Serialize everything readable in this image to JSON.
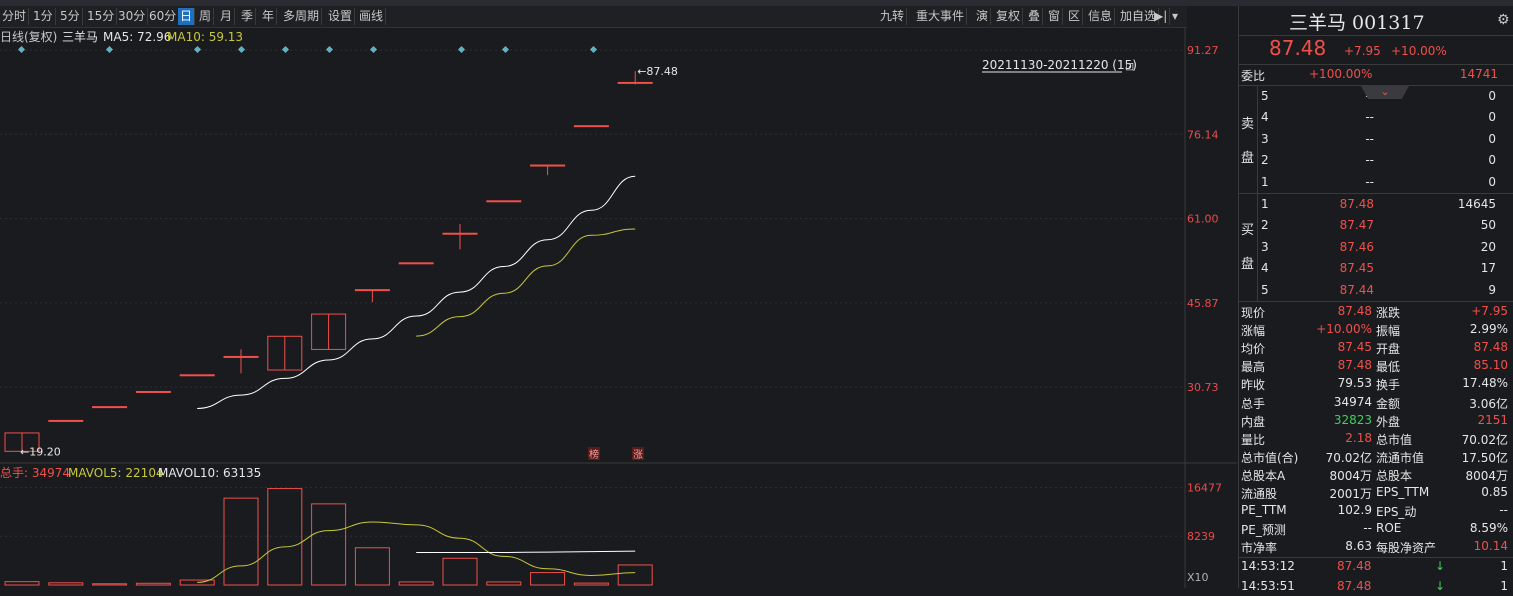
{
  "toolbar": {
    "periods": [
      "分时",
      "1分",
      "5分",
      "15分",
      "30分",
      "60分",
      "日",
      "周",
      "月",
      "季",
      "年",
      "多周期",
      "设置",
      "画线"
    ],
    "active": "日",
    "right_buttons": [
      "九转",
      "重大事件",
      "演",
      "复权",
      "叠",
      "窗",
      "区",
      "信息",
      "加自选"
    ]
  },
  "chart_legend": {
    "period_label": "日线(复权)",
    "stock_name": "三羊马",
    "ma5": "MA5: 72.96",
    "ma10": "MA10: 59.13"
  },
  "range_label": "20211130-20211220 (15)",
  "price_axis": [
    "91.27",
    "76.14",
    "61.00",
    "45.87",
    "30.73"
  ],
  "vol_axis": [
    "16477",
    "8239",
    "X10"
  ],
  "vol_legend": {
    "total": "总手: 34974",
    "mavol5": "MAVOL5: 22104",
    "mavol10": "MAVOL10: 63135"
  },
  "annotations": {
    "high": "87.48",
    "low": "19.20",
    "bang": "榜",
    "zhang": "涨"
  },
  "colors": {
    "up": "#f0504a",
    "ma5": "#ffffff",
    "ma10": "#c8c83a",
    "cyan": "#5ab4c8",
    "grid": "#2e2f35"
  },
  "chart_data": {
    "type": "candlestick",
    "dates_range": "20211130-20211220",
    "candles": [
      {
        "o": 19.2,
        "c": 22.5,
        "h": 22.5,
        "l": 19.2,
        "v": 3.5
      },
      {
        "o": 24.75,
        "c": 24.75,
        "h": 24.75,
        "l": 24.75,
        "v": 2.3
      },
      {
        "o": 27.23,
        "c": 27.23,
        "h": 27.23,
        "l": 27.23,
        "v": 1.3
      },
      {
        "o": 29.95,
        "c": 29.95,
        "h": 29.95,
        "l": 29.95,
        "v": 1.8
      },
      {
        "o": 32.95,
        "c": 32.95,
        "h": 32.95,
        "l": 32.95,
        "v": 5.2
      },
      {
        "o": 36.24,
        "c": 36.24,
        "h": 37.5,
        "l": 33.2,
        "v": 91
      },
      {
        "o": 33.8,
        "c": 39.86,
        "h": 39.86,
        "l": 33.8,
        "v": 101
      },
      {
        "o": 37.5,
        "c": 43.85,
        "h": 43.85,
        "l": 37.5,
        "v": 85
      },
      {
        "o": 48.24,
        "c": 48.24,
        "h": 48.24,
        "l": 46.0,
        "v": 39
      },
      {
        "o": 53.06,
        "c": 53.06,
        "h": 53.06,
        "l": 53.06,
        "v": 3.2
      },
      {
        "o": 58.37,
        "c": 58.37,
        "h": 60.0,
        "l": 55.5,
        "v": 28
      },
      {
        "o": 64.2,
        "c": 64.2,
        "h": 64.2,
        "l": 64.2,
        "v": 3.2
      },
      {
        "o": 70.62,
        "c": 70.62,
        "h": 70.62,
        "l": 68.8,
        "v": 13
      },
      {
        "o": 77.69,
        "c": 77.69,
        "h": 77.69,
        "l": 77.69,
        "v": 2.0
      },
      {
        "o": 85.46,
        "c": 85.46,
        "h": 87.48,
        "l": 85.1,
        "v": 21
      }
    ],
    "ma5": [
      null,
      null,
      null,
      null,
      26.9,
      29.3,
      32.3,
      35.6,
      39.4,
      43.5,
      47.8,
      52.4,
      57.2,
      62.5,
      68.6
    ],
    "ma10": [
      null,
      null,
      null,
      null,
      null,
      null,
      null,
      null,
      null,
      39.9,
      43.4,
      47.6,
      52.5,
      58.0,
      59.13
    ],
    "mavol5": [
      null,
      null,
      null,
      null,
      2.8,
      20,
      40,
      57,
      66,
      63,
      49,
      30,
      17,
      10,
      13
    ],
    "mavol10": [
      null,
      null,
      null,
      null,
      null,
      null,
      null,
      null,
      null,
      34,
      34,
      34,
      34.5,
      35,
      35.5
    ],
    "ylim": [
      18,
      92
    ],
    "vol_ylim": [
      0,
      110
    ]
  },
  "quote": {
    "title": "三羊马 001317",
    "price": "87.48",
    "change": "+7.95",
    "pct": "+10.00%",
    "weibi_label": "委比",
    "weibi": "+100.00%",
    "weicha": "14741",
    "sell_label": [
      "卖",
      "盘"
    ],
    "buy_label": [
      "买",
      "盘"
    ],
    "sell": [
      {
        "lvl": "5",
        "price": "--",
        "vol": "0"
      },
      {
        "lvl": "4",
        "price": "--",
        "vol": "0"
      },
      {
        "lvl": "3",
        "price": "--",
        "vol": "0"
      },
      {
        "lvl": "2",
        "price": "--",
        "vol": "0"
      },
      {
        "lvl": "1",
        "price": "--",
        "vol": "0"
      }
    ],
    "buy": [
      {
        "lvl": "1",
        "price": "87.48",
        "vol": "14645"
      },
      {
        "lvl": "2",
        "price": "87.47",
        "vol": "50"
      },
      {
        "lvl": "3",
        "price": "87.46",
        "vol": "20"
      },
      {
        "lvl": "4",
        "price": "87.45",
        "vol": "17"
      },
      {
        "lvl": "5",
        "price": "87.44",
        "vol": "9"
      }
    ],
    "stats": [
      {
        "k1": "现价",
        "v1": "87.48",
        "c1": "red",
        "k2": "涨跌",
        "v2": "+7.95",
        "c2": "red"
      },
      {
        "k1": "涨幅",
        "v1": "+10.00%",
        "c1": "red",
        "k2": "振幅",
        "v2": "2.99%",
        "c2": "white"
      },
      {
        "k1": "均价",
        "v1": "87.45",
        "c1": "red",
        "k2": "开盘",
        "v2": "87.48",
        "c2": "red"
      },
      {
        "k1": "最高",
        "v1": "87.48",
        "c1": "red",
        "k2": "最低",
        "v2": "85.10",
        "c2": "red"
      },
      {
        "k1": "昨收",
        "v1": "79.53",
        "c1": "white",
        "k2": "换手",
        "v2": "17.48%",
        "c2": "white"
      },
      {
        "k1": "总手",
        "v1": "34974",
        "c1": "white",
        "k2": "金额",
        "v2": "3.06亿",
        "c2": "white"
      },
      {
        "k1": "内盘",
        "v1": "32823",
        "c1": "green",
        "k2": "外盘",
        "v2": "2151",
        "c2": "red"
      },
      {
        "k1": "量比",
        "v1": "2.18",
        "c1": "red",
        "k2": "总市值",
        "v2": "70.02亿",
        "c2": "white"
      },
      {
        "k1": "总市值(合)",
        "v1": "70.02亿",
        "c1": "white",
        "k2": "流通市值",
        "v2": "17.50亿",
        "c2": "white"
      },
      {
        "k1": "总股本A",
        "v1": "8004万",
        "c1": "white",
        "k2": "总股本",
        "v2": "8004万",
        "c2": "white"
      },
      {
        "k1": "流通股",
        "v1": "2001万",
        "c1": "white",
        "k2": "EPS_TTM",
        "v2": "0.85",
        "c2": "white"
      },
      {
        "k1": "PE_TTM",
        "v1": "102.9",
        "c1": "white",
        "k2": "EPS_动",
        "v2": "--",
        "c2": "white"
      },
      {
        "k1": "PE_预测",
        "v1": "--",
        "c1": "white",
        "k2": "ROE",
        "v2": "8.59%",
        "c2": "white"
      },
      {
        "k1": "市净率",
        "v1": "8.63",
        "c1": "white",
        "k2": "每股净资产",
        "v2": "10.14",
        "c2": "red"
      }
    ],
    "ticks": [
      {
        "time": "14:53:12",
        "price": "87.48",
        "vol": "1"
      },
      {
        "time": "14:53:51",
        "price": "87.48",
        "vol": "1"
      }
    ]
  }
}
